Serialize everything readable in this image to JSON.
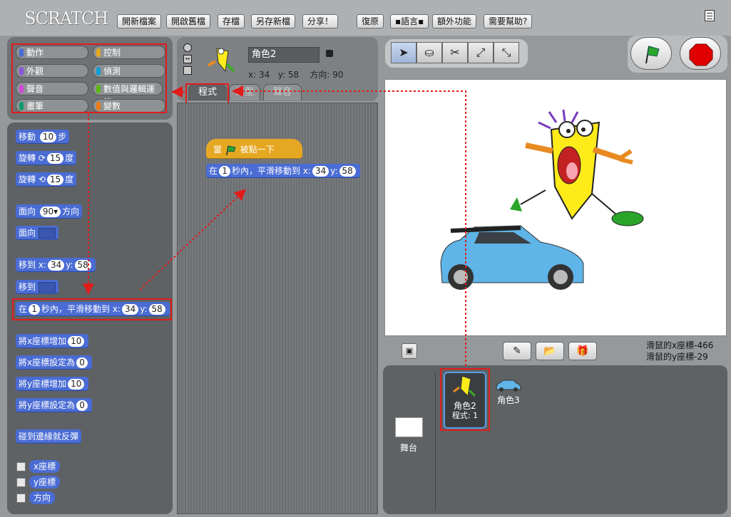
{
  "menu": {
    "logo": "SCRATCH",
    "items": [
      "開新檔案",
      "開啟舊檔",
      "存檔",
      "另存新檔",
      "分享！",
      "復原",
      "▪語言▪",
      "額外功能",
      "需要幫助?"
    ]
  },
  "categories": [
    {
      "label": "動作",
      "color": "#4a6cd4"
    },
    {
      "label": "控制",
      "color": "#e6a822"
    },
    {
      "label": "外觀",
      "color": "#8a55d7"
    },
    {
      "label": "偵測",
      "color": "#0e9ed6"
    },
    {
      "label": "聲音",
      "color": "#cf4ad9"
    },
    {
      "label": "數值與邏輯運算",
      "color": "#5cb712"
    },
    {
      "label": "畫筆",
      "color": "#0e9a6c"
    },
    {
      "label": "變數",
      "color": "#ee7d16"
    }
  ],
  "palette": {
    "move": {
      "a": "移動",
      "n": "10",
      "b": "步"
    },
    "turn_cw": {
      "a": "旋轉",
      "icon": "⟳",
      "n": "15",
      "b": "度"
    },
    "turn_ccw": {
      "a": "旋轉",
      "icon": "⟲",
      "n": "15",
      "b": "度"
    },
    "point_dir": {
      "a": "面向",
      "n": "90▾",
      "b": "方向"
    },
    "point_to": {
      "a": "面向"
    },
    "goto_xy": {
      "a": "移到 x:",
      "x": "34",
      "b": "y:",
      "y": "58"
    },
    "goto": {
      "a": "移到"
    },
    "glide": {
      "a": "在",
      "n": "1",
      "b": "秒內，平滑移動到 x:",
      "x": "34",
      "c": "y:",
      "y": "58"
    },
    "change_x": {
      "a": "將x座標增加",
      "n": "10"
    },
    "set_x": {
      "a": "將x座標設定為",
      "n": "0"
    },
    "change_y": {
      "a": "將y座標增加",
      "n": "10"
    },
    "set_y": {
      "a": "將y座標設定為",
      "n": "0"
    },
    "bounce": "碰到邊緣就反彈",
    "reporters": [
      "x座標",
      "y座標",
      "方向"
    ]
  },
  "sprite": {
    "name": "角色2",
    "x_label": "x:",
    "x": "34",
    "y_label": "y:",
    "y": "58",
    "dir_label": "方向:",
    "dir": "90"
  },
  "tabs": [
    "程式",
    "造型",
    "聲音"
  ],
  "script": {
    "hat_a": "當",
    "hat_b": "被點一下",
    "glide_a": "在",
    "glide_n": "1",
    "glide_b": "秒內，平滑移動到 x:",
    "glide_x": "34",
    "glide_c": "y:",
    "glide_y": "58"
  },
  "mouse": {
    "x_label": "滑鼠的x座標",
    "x": "-466",
    "y_label": "滑鼠的y座標",
    "y": "-29"
  },
  "sprites_panel": {
    "stage_label": "舞台",
    "s1_name": "角色2",
    "s1_scripts": "程式: 1",
    "s2_name": "角色3"
  },
  "colors": {
    "motion": "#4a6cd4",
    "control": "#e6a822",
    "highlight": "#e21b1b",
    "flag": "#2aa52a",
    "stop": "#e00000"
  }
}
